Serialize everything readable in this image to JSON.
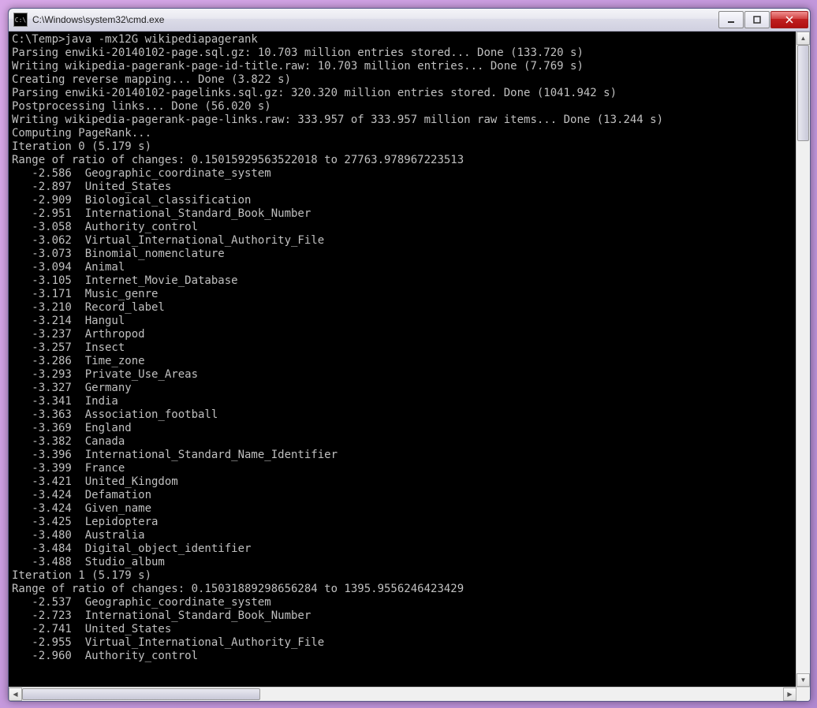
{
  "window": {
    "title": "C:\\Windows\\system32\\cmd.exe",
    "icon_label": "C:\\"
  },
  "prompt": "C:\\Temp>",
  "command": "java -mx12G wikipediapagerank",
  "log_lines": [
    "Parsing enwiki-20140102-page.sql.gz: 10.703 million entries stored... Done (133.720 s)",
    "Writing wikipedia-pagerank-page-id-title.raw: 10.703 million entries... Done (7.769 s)",
    "Creating reverse mapping... Done (3.822 s)",
    "Parsing enwiki-20140102-pagelinks.sql.gz: 320.320 million entries stored. Done (1041.942 s)",
    "Postprocessing links... Done (56.020 s)",
    "Writing wikipedia-pagerank-page-links.raw: 333.957 of 333.957 million raw items... Done (13.244 s)",
    "Computing PageRank...",
    "Iteration 0 (5.179 s)",
    "Range of ratio of changes: 0.15015929563522018 to 27763.978967223513"
  ],
  "iter0_rows": [
    {
      "v": "-2.586",
      "n": "Geographic_coordinate_system"
    },
    {
      "v": "-2.897",
      "n": "United_States"
    },
    {
      "v": "-2.909",
      "n": "Biological_classification"
    },
    {
      "v": "-2.951",
      "n": "International_Standard_Book_Number"
    },
    {
      "v": "-3.058",
      "n": "Authority_control"
    },
    {
      "v": "-3.062",
      "n": "Virtual_International_Authority_File"
    },
    {
      "v": "-3.073",
      "n": "Binomial_nomenclature"
    },
    {
      "v": "-3.094",
      "n": "Animal"
    },
    {
      "v": "-3.105",
      "n": "Internet_Movie_Database"
    },
    {
      "v": "-3.171",
      "n": "Music_genre"
    },
    {
      "v": "-3.210",
      "n": "Record_label"
    },
    {
      "v": "-3.214",
      "n": "Hangul"
    },
    {
      "v": "-3.237",
      "n": "Arthropod"
    },
    {
      "v": "-3.257",
      "n": "Insect"
    },
    {
      "v": "-3.286",
      "n": "Time_zone"
    },
    {
      "v": "-3.293",
      "n": "Private_Use_Areas"
    },
    {
      "v": "-3.327",
      "n": "Germany"
    },
    {
      "v": "-3.341",
      "n": "India"
    },
    {
      "v": "-3.363",
      "n": "Association_football"
    },
    {
      "v": "-3.369",
      "n": "England"
    },
    {
      "v": "-3.382",
      "n": "Canada"
    },
    {
      "v": "-3.396",
      "n": "International_Standard_Name_Identifier"
    },
    {
      "v": "-3.399",
      "n": "France"
    },
    {
      "v": "-3.421",
      "n": "United_Kingdom"
    },
    {
      "v": "-3.424",
      "n": "Defamation"
    },
    {
      "v": "-3.424",
      "n": "Given_name"
    },
    {
      "v": "-3.425",
      "n": "Lepidoptera"
    },
    {
      "v": "-3.480",
      "n": "Australia"
    },
    {
      "v": "-3.484",
      "n": "Digital_object_identifier"
    },
    {
      "v": "-3.488",
      "n": "Studio_album"
    }
  ],
  "iter1_header": [
    "Iteration 1 (5.179 s)",
    "Range of ratio of changes: 0.15031889298656284 to 1395.9556246423429"
  ],
  "iter1_rows": [
    {
      "v": "-2.537",
      "n": "Geographic_coordinate_system"
    },
    {
      "v": "-2.723",
      "n": "International_Standard_Book_Number"
    },
    {
      "v": "-2.741",
      "n": "United_States"
    },
    {
      "v": "-2.955",
      "n": "Virtual_International_Authority_File"
    },
    {
      "v": "-2.960",
      "n": "Authority_control"
    }
  ]
}
